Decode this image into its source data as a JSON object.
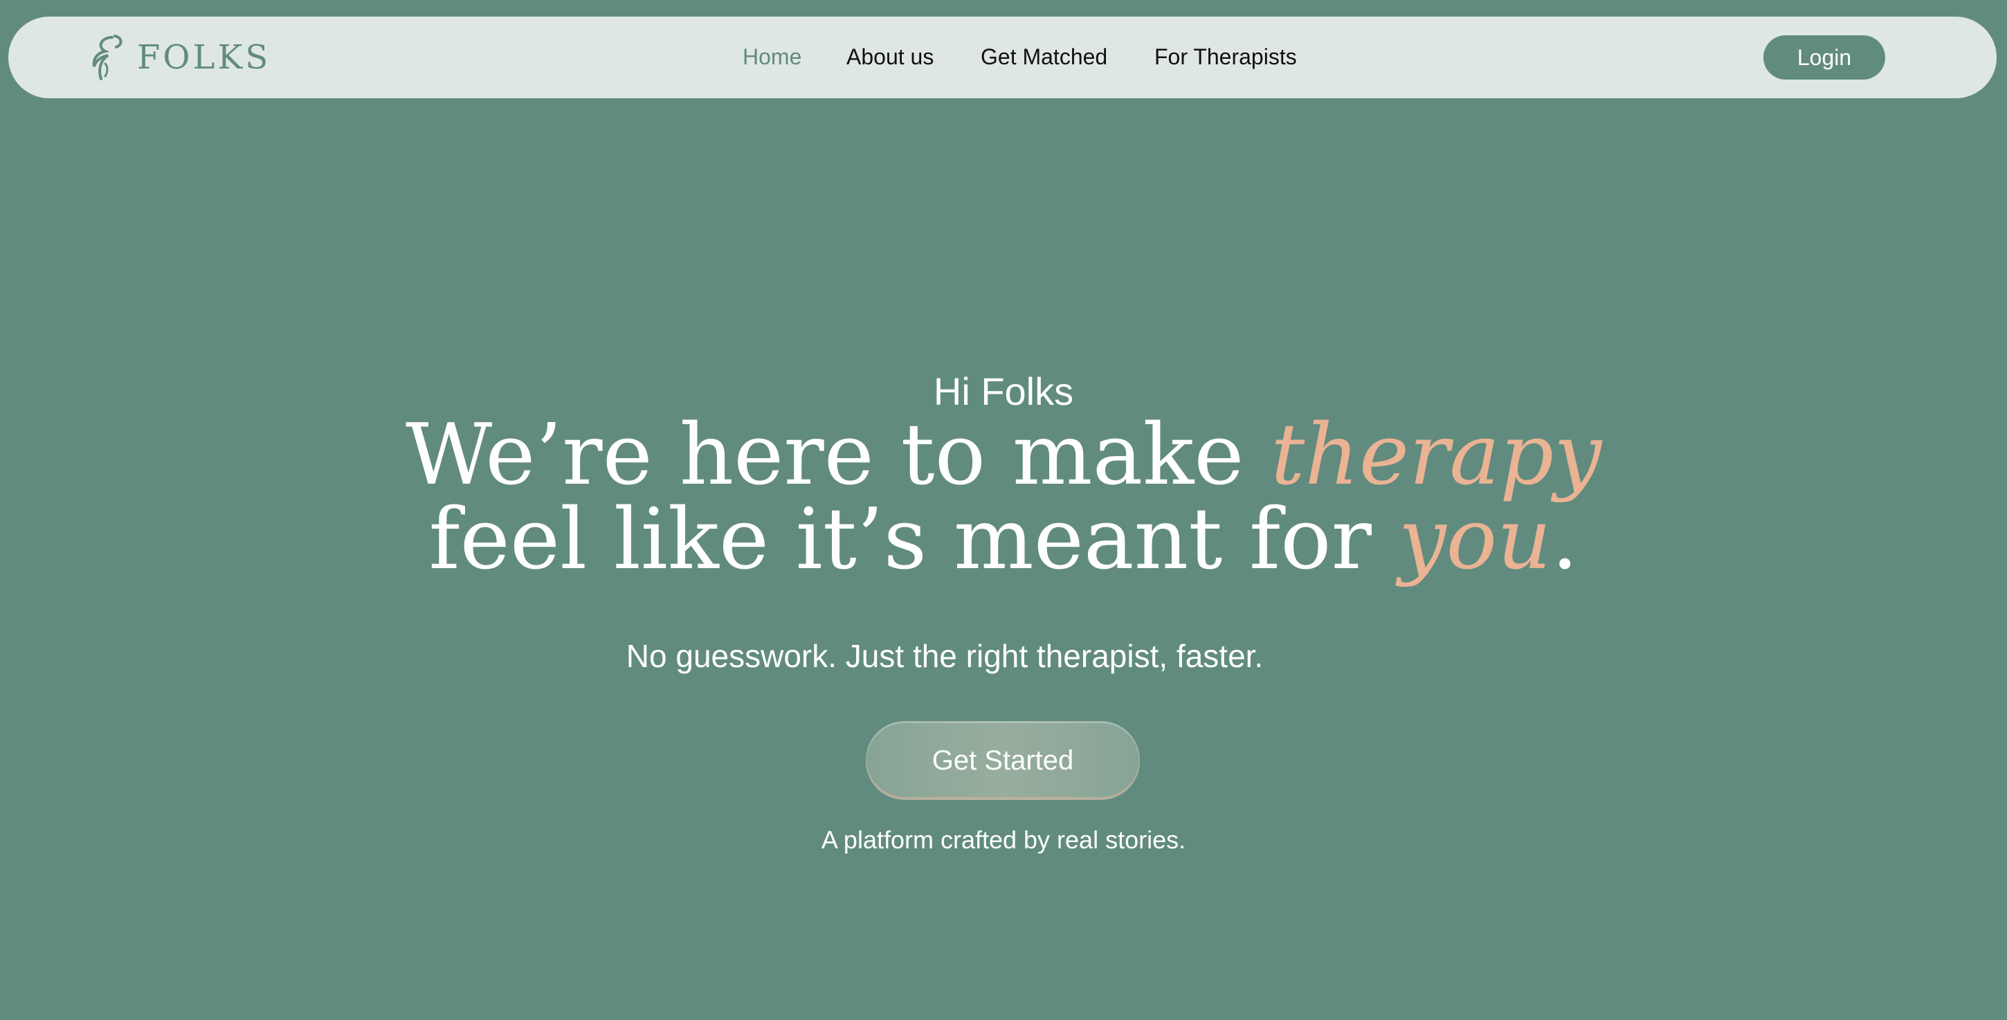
{
  "brand": {
    "name": "FOLKS"
  },
  "nav": {
    "links": [
      {
        "label": "Home",
        "active": true
      },
      {
        "label": "About us",
        "active": false
      },
      {
        "label": "Get Matched",
        "active": false
      },
      {
        "label": "For Therapists",
        "active": false
      }
    ],
    "login_label": "Login"
  },
  "hero": {
    "greeting": "Hi Folks",
    "headline_line1_prefix": "We’re here to make ",
    "headline_line1_accent": "therapy",
    "headline_line2_prefix": "feel like it’s meant for ",
    "headline_line2_accent": "you",
    "headline_line2_suffix": ".",
    "subheadline": "No guesswork. Just the right therapist, faster.",
    "cta_label": "Get Started",
    "tagline": "A platform crafted by real stories."
  },
  "colors": {
    "background": "#618b7e",
    "navbar": "#dfe7e3",
    "accent": "#eab394",
    "brand_green": "#618b7e"
  },
  "icons": {
    "logo": "leaf-swirl-icon"
  }
}
